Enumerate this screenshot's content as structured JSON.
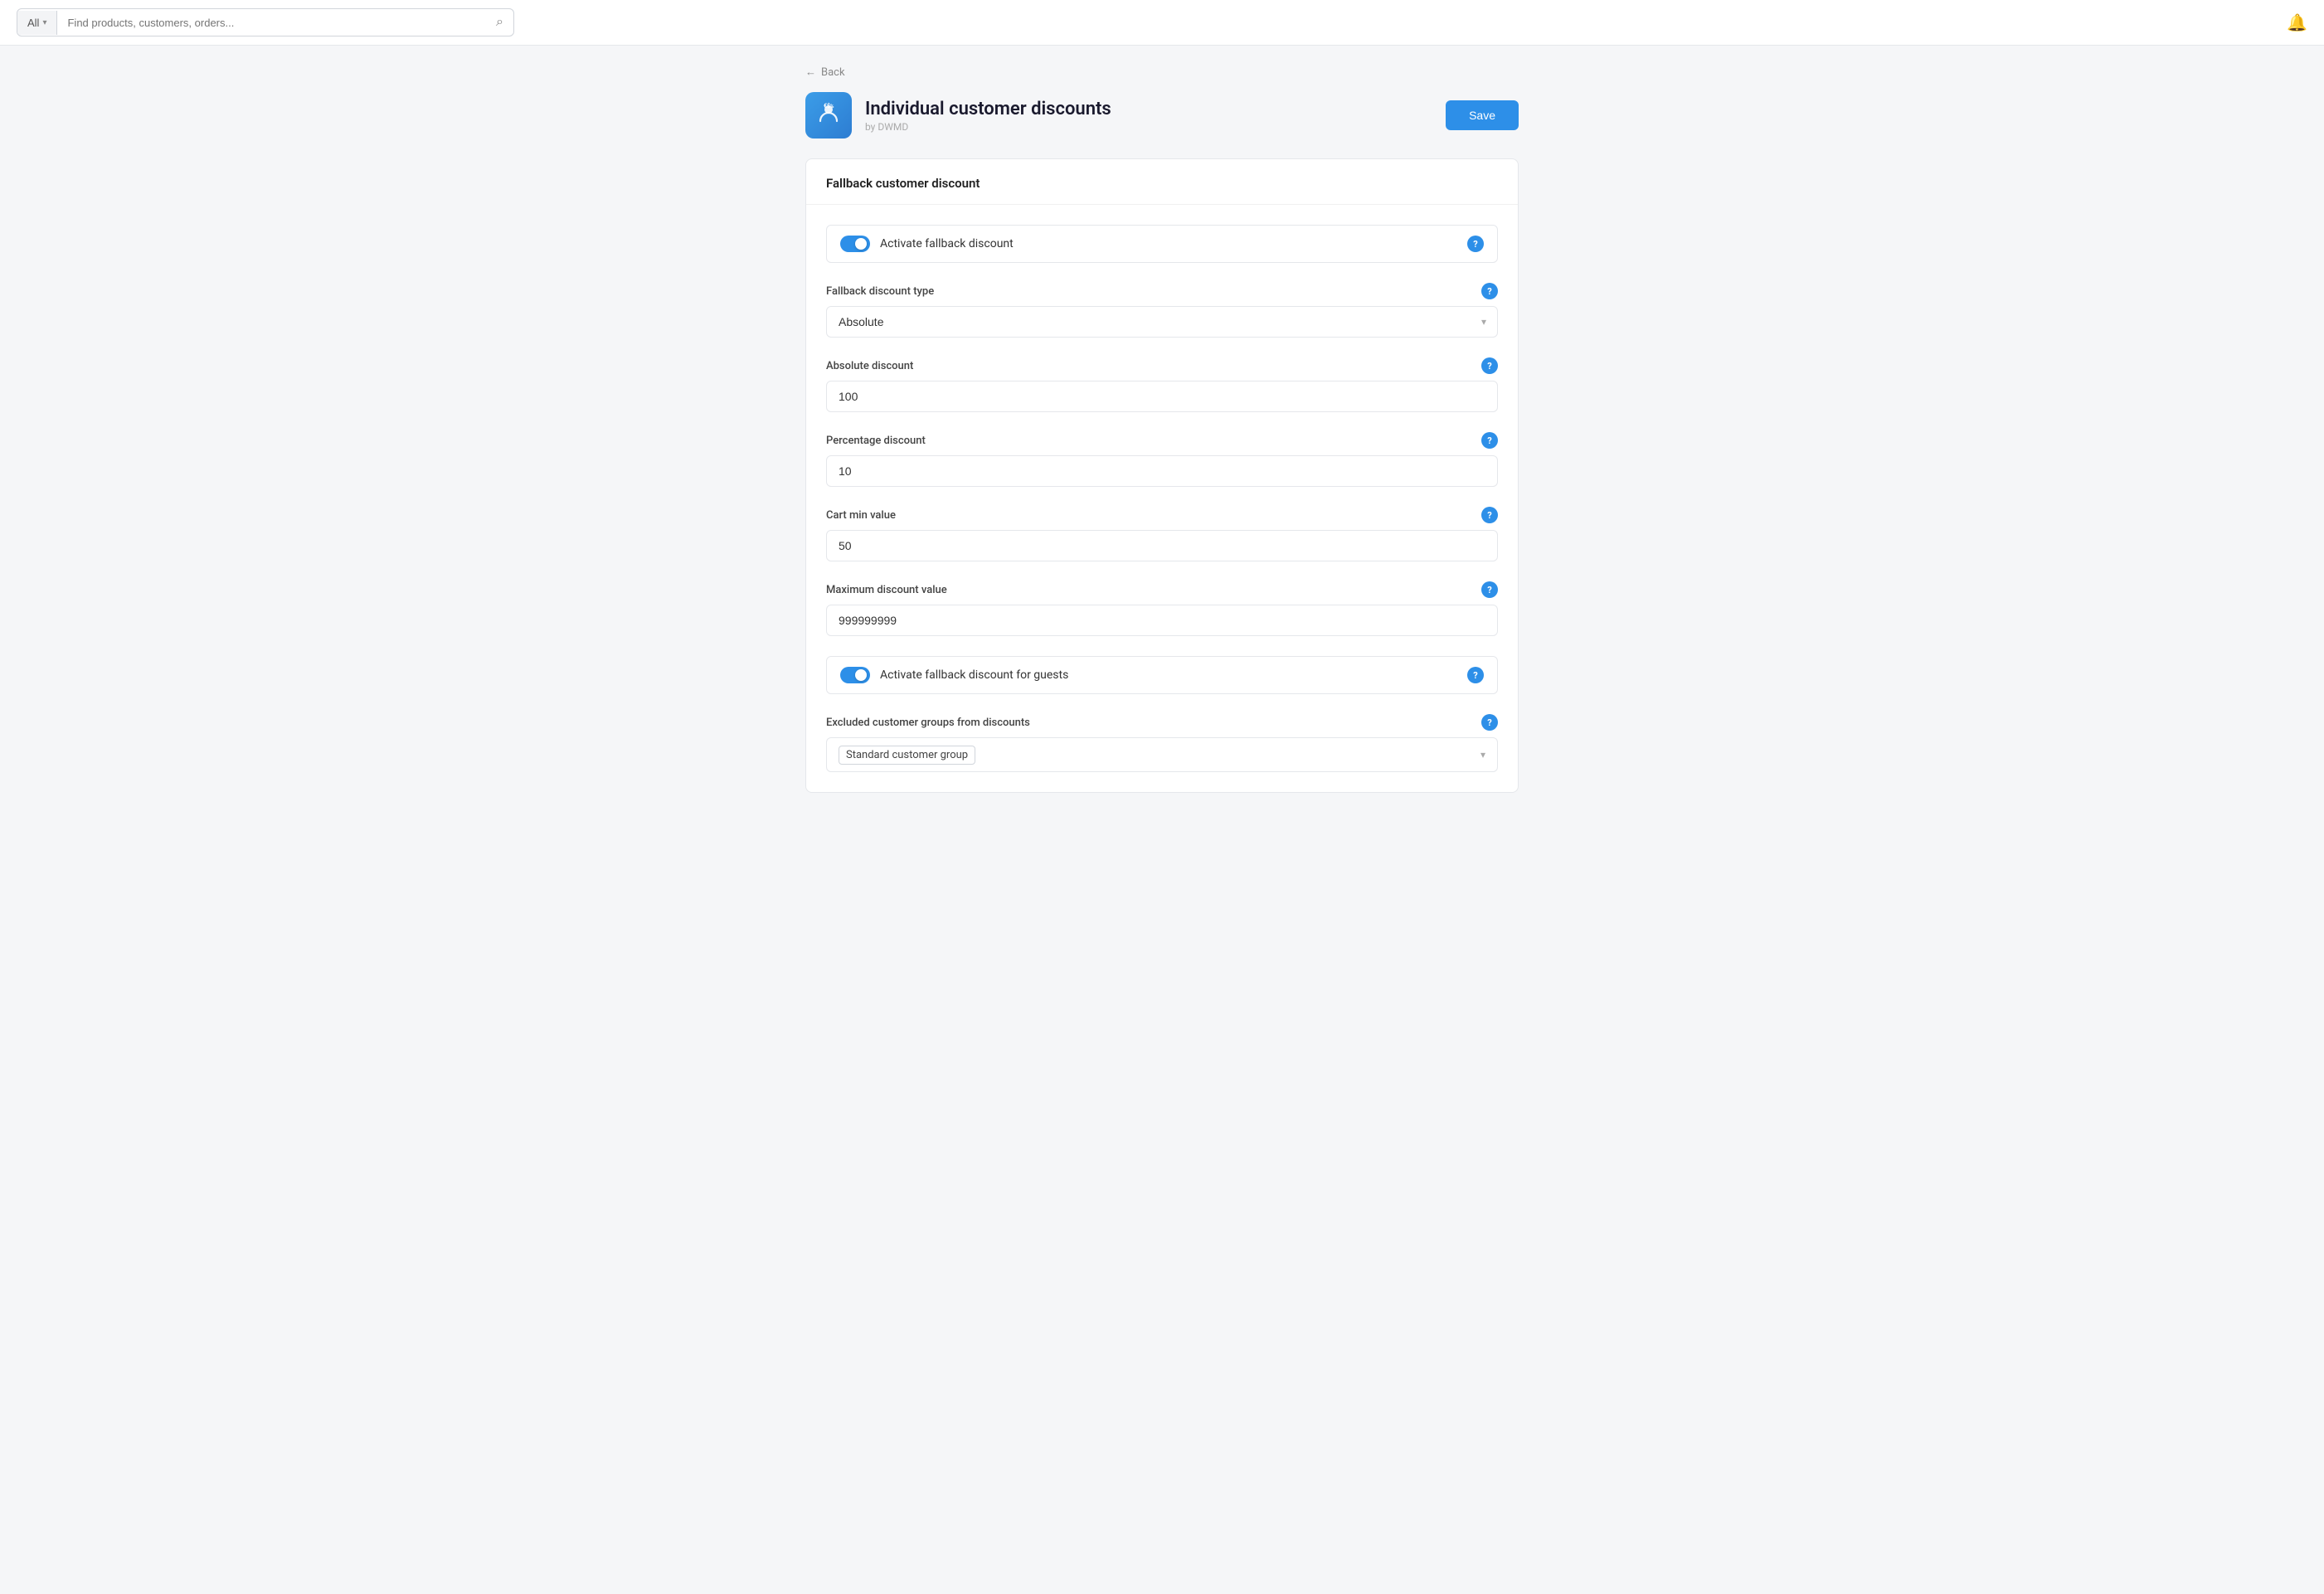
{
  "nav": {
    "search_all_label": "All",
    "search_placeholder": "Find products, customers, orders...",
    "search_chevron": "▾",
    "search_icon": "🔍",
    "bell_icon": "🔔"
  },
  "back": {
    "label": "Back",
    "arrow": "←"
  },
  "header": {
    "plugin_icon": "€$%",
    "title": "Individual customer discounts",
    "subtitle": "by DWMD",
    "save_label": "Save"
  },
  "card": {
    "title": "Fallback customer discount"
  },
  "form": {
    "activate_fallback_label": "Activate fallback discount",
    "fallback_type_label": "Fallback discount type",
    "fallback_type_value": "Absolute",
    "absolute_discount_label": "Absolute discount",
    "absolute_discount_value": "100",
    "percentage_discount_label": "Percentage discount",
    "percentage_discount_value": "10",
    "cart_min_label": "Cart min value",
    "cart_min_value": "50",
    "max_discount_label": "Maximum discount value",
    "max_discount_value": "999999999",
    "activate_guests_label": "Activate fallback discount for guests",
    "excluded_groups_label": "Excluded customer groups from discounts",
    "excluded_group_tag": "Standard customer group"
  },
  "help_icon_label": "?",
  "dropdown_chevron": "▾"
}
